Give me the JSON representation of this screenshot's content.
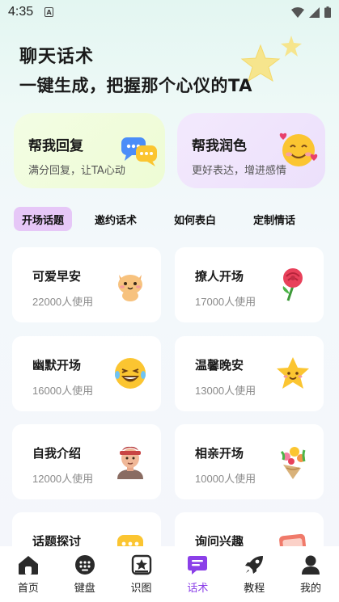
{
  "status_bar": {
    "time": "4:35",
    "notif_letter": "A"
  },
  "header": {
    "title": "聊天话术",
    "subtitle": "一键生成，把握那个心仪的TA"
  },
  "features": [
    {
      "title": "帮我回复",
      "subtitle": "满分回复，让TA心动",
      "icon": "chat-bubbles-icon"
    },
    {
      "title": "帮我润色",
      "subtitle": "更好表达，增进感情",
      "icon": "smiling-hearts-emoji-icon"
    }
  ],
  "tabs": [
    "开场话题",
    "邀约话术",
    "如何表白",
    "定制情话"
  ],
  "active_tab": "开场话题",
  "cards": [
    {
      "name": "可爱早安",
      "count": "22000人使用",
      "icon": "cat-icon"
    },
    {
      "name": "撩人开场",
      "count": "17000人使用",
      "icon": "rose-icon"
    },
    {
      "name": "幽默开场",
      "count": "16000人使用",
      "icon": "laughing-emoji-icon"
    },
    {
      "name": "温馨晚安",
      "count": "13000人使用",
      "icon": "star-emoji-icon"
    },
    {
      "name": "自我介绍",
      "count": "12000人使用",
      "icon": "person-avatar-icon"
    },
    {
      "name": "相亲开场",
      "count": "10000人使用",
      "icon": "bouquet-icon"
    },
    {
      "name": "话题探讨",
      "count": "",
      "icon": "speech-bubble-icon"
    },
    {
      "name": "询问兴趣",
      "count": "",
      "icon": "photo-icon"
    }
  ],
  "bottom_nav": [
    {
      "label": "首页",
      "icon": "home-icon"
    },
    {
      "label": "键盘",
      "icon": "keyboard-icon"
    },
    {
      "label": "识图",
      "icon": "image-recognition-icon"
    },
    {
      "label": "话术",
      "icon": "chat-script-icon"
    },
    {
      "label": "教程",
      "icon": "rocket-icon"
    },
    {
      "label": "我的",
      "icon": "profile-icon"
    }
  ],
  "active_nav": "话术",
  "colors": {
    "accent": "#8b3fe8",
    "active_tab_bg": "#e6c7f7",
    "reply_card": "#f1fcdd",
    "polish_card": "#efe3fc"
  }
}
